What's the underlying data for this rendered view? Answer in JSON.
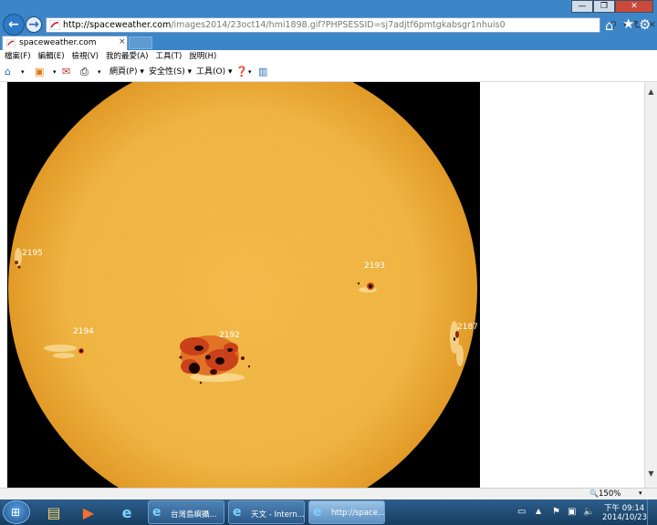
{
  "browser": {
    "url_domain": "http://spaceweather.com",
    "url_rest": "/images2014/23oct14/hmi1898.gif?PHPSESSID=sj7adjtf6pmtgkabsgr1nhuis0",
    "tab_title": "spaceweather.com",
    "tab_close": "×",
    "window_controls": {
      "minimize": "—",
      "restore": "❐",
      "close": "✕"
    }
  },
  "menu": [
    "檔案(F)",
    "編輯(E)",
    "檢視(V)",
    "我的最愛(A)",
    "工具(T)",
    "說明(H)"
  ],
  "commandbar": {
    "page": "網頁(P)",
    "safety": "安全性(S)",
    "tools": "工具(O)"
  },
  "sunspots": [
    {
      "label": "2195"
    },
    {
      "label": "2193"
    },
    {
      "label": "2194"
    },
    {
      "label": "2192"
    },
    {
      "label": "2187"
    }
  ],
  "status": {
    "zoom": "150%"
  },
  "taskbar": {
    "buttons": [
      {
        "label": "台灣島嶼攝..."
      },
      {
        "label": "天文 - Intern..."
      },
      {
        "label": "http://space..."
      }
    ],
    "clock_time": "下午 09:14",
    "clock_date": "2014/10/23"
  },
  "colors": {
    "sun_disk": "#f2b43a",
    "sun_limb": "#e59a1a",
    "spot_dark": "#1a0400",
    "spot_penumbra": "#c9401a"
  }
}
